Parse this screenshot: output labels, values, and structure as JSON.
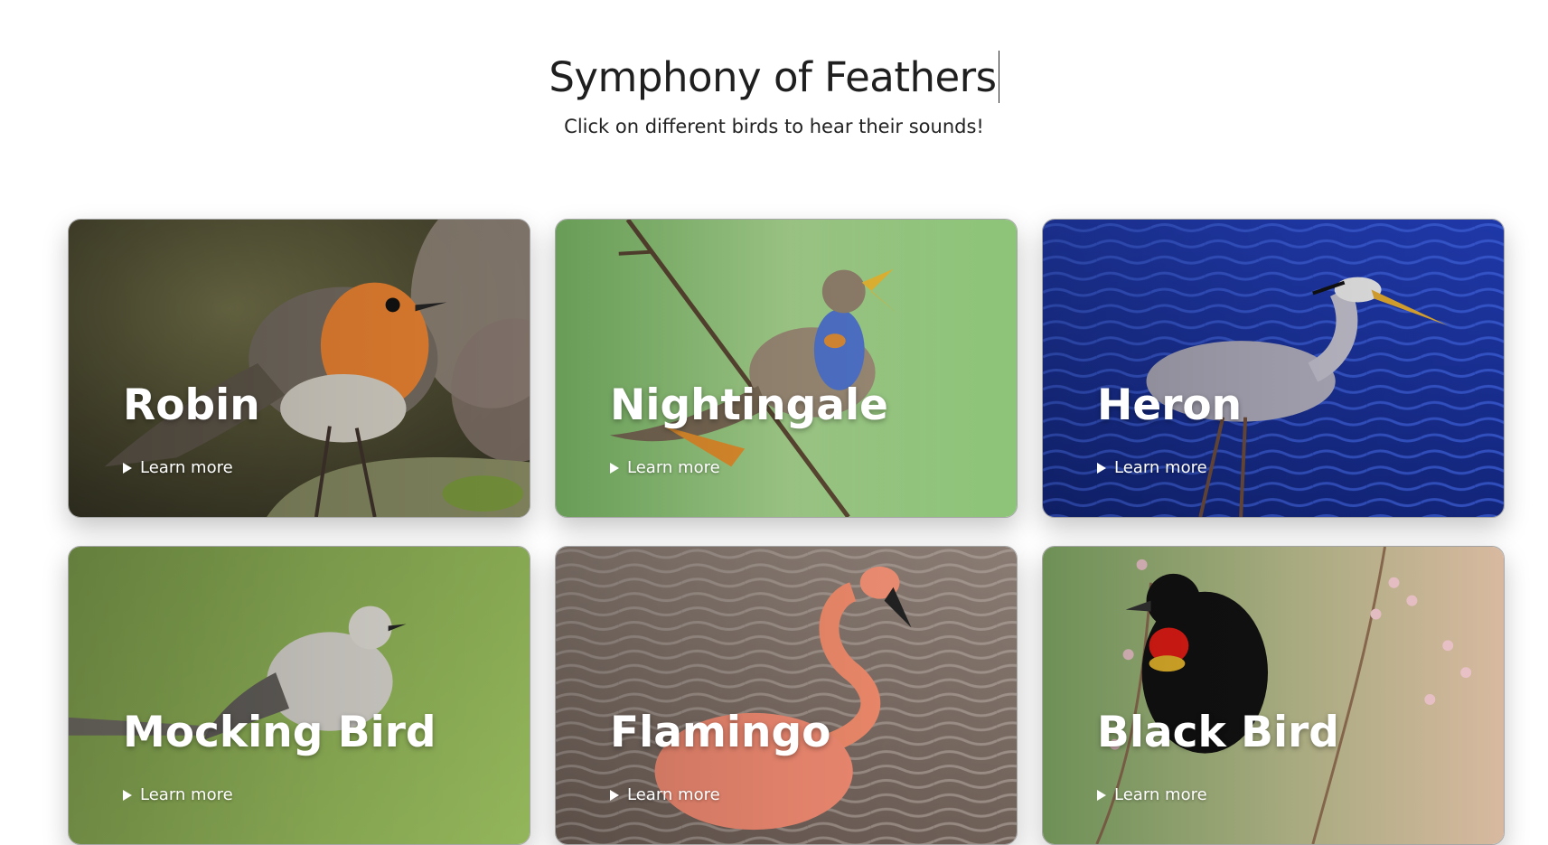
{
  "header": {
    "title": "Symphony of Feathers",
    "subtitle": "Click on different birds to hear their sounds!"
  },
  "birds": [
    {
      "name": "Robin",
      "learn_more": "Learn more",
      "icon": "robin-photo"
    },
    {
      "name": "Nightingale",
      "learn_more": "Learn more",
      "icon": "nightingale-photo"
    },
    {
      "name": "Heron",
      "learn_more": "Learn more",
      "icon": "heron-photo"
    },
    {
      "name": "Mocking Bird",
      "learn_more": "Learn more",
      "icon": "mocking-bird-photo"
    },
    {
      "name": "Flamingo",
      "learn_more": "Learn more",
      "icon": "flamingo-photo"
    },
    {
      "name": "Black Bird",
      "learn_more": "Learn more",
      "icon": "black-bird-photo"
    }
  ],
  "colors": {
    "title_text": "#1f1f1f",
    "card_text": "#ffffff"
  }
}
